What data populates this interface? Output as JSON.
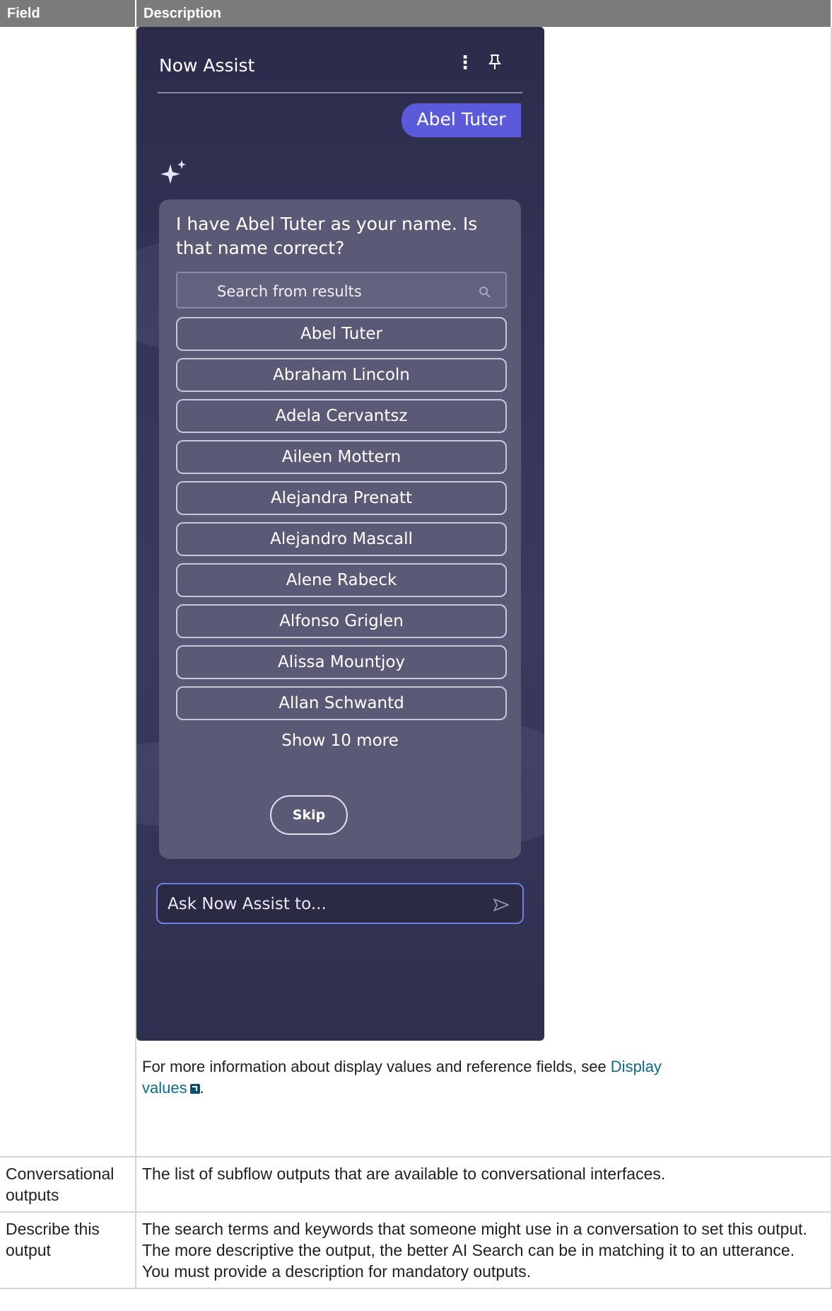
{
  "table": {
    "headers": [
      "Field",
      "Description"
    ],
    "rows": [
      {
        "field": "",
        "info_prefix": "For more information about display values and reference fields, see ",
        "info_link": "Display values",
        "info_suffix": "."
      },
      {
        "field": "Conversational outputs",
        "description": "The list of subflow outputs that are available to conversational interfaces."
      },
      {
        "field": "Describe this output",
        "description": "The search terms and keywords that someone might use in a conversation to set this output. The more descriptive the output, the better AI Search can be in matching it to an utterance. You must provide a description for mandatory outputs."
      }
    ]
  },
  "assist": {
    "title": "Now Assist",
    "user_message": "Abel Tuter",
    "bot_question": "I have Abel Tuter as your name. Is that name correct?",
    "search_placeholder": "Search from results",
    "options": [
      "Abel Tuter",
      "Abraham Lincoln",
      "Adela Cervantsz",
      "Aileen Mottern",
      "Alejandra Prenatt",
      "Alejandro Mascall",
      "Alene Rabeck",
      "Alfonso Griglen",
      "Alissa Mountjoy",
      "Allan Schwantd"
    ],
    "show_more": "Show 10 more",
    "skip": "Skip",
    "input_placeholder": "Ask Now Assist to..."
  }
}
